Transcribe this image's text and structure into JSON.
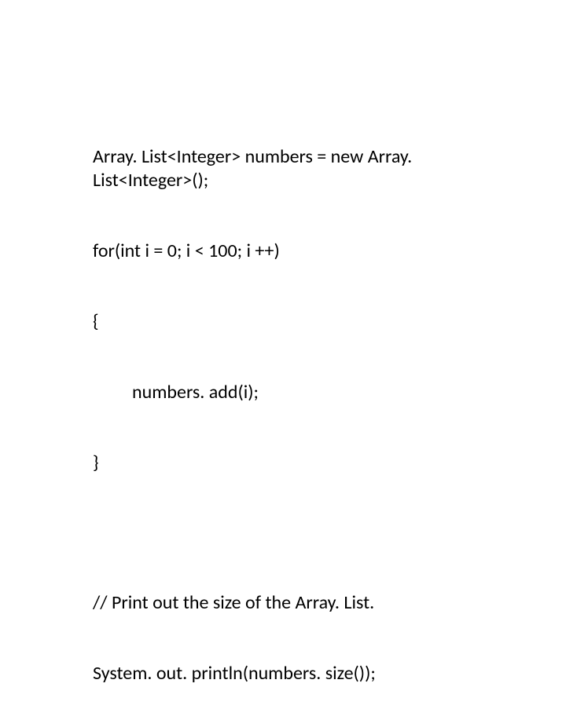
{
  "code": {
    "line1": "Array. List<Integer> numbers = new Array. List<Integer>();",
    "line2": "for(int i = 0; i < 100; i ++)",
    "line3": "{",
    "line4": "numbers. add(i);",
    "line5": "}",
    "line6": "// Print out the size of the Array. List.",
    "line7": "System. out. println(numbers. size());"
  }
}
